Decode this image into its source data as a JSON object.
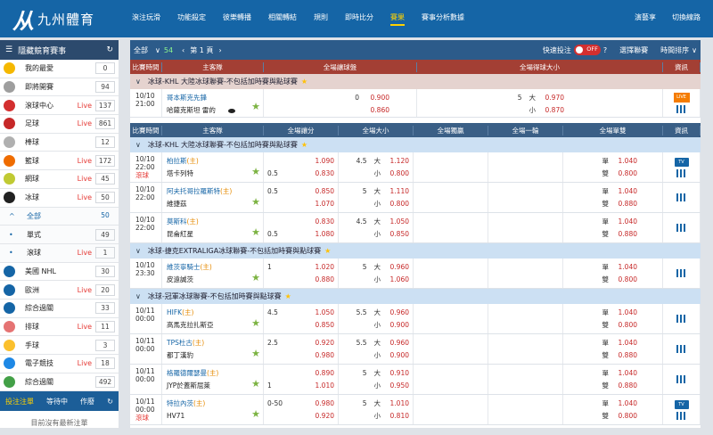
{
  "header": {
    "logo_mark": "从",
    "logo_text": "九州體育",
    "nav": [
      "滾注玩滑",
      "功能殺定",
      "彼樂轉播",
      "相關轉結",
      "規則",
      "即時比分",
      "賽果",
      "賽事分析數據"
    ],
    "nav_active_index": 6,
    "right": [
      "演藝享",
      "切換線路"
    ]
  },
  "sidebar": {
    "title": "隱藏競育賽事",
    "items": [
      {
        "label": "我的最愛",
        "count": "0",
        "icon": "star-icon",
        "color": "#f5b800"
      },
      {
        "label": "即將開賽",
        "count": "94",
        "icon": "clock-icon",
        "color": "#9e9e9e"
      },
      {
        "label": "滾球中心",
        "live": "Live",
        "count": "137",
        "icon": "play-icon",
        "color": "#d32f2f"
      },
      {
        "label": "足球",
        "live": "Live",
        "count": "861",
        "icon": "soccer-icon",
        "color": "#c62828"
      },
      {
        "label": "棒球",
        "count": "12",
        "icon": "baseball-icon",
        "color": "#b0b0b0"
      },
      {
        "label": "籃球",
        "live": "Live",
        "count": "172",
        "icon": "basketball-icon",
        "color": "#ef6c00"
      },
      {
        "label": "網球",
        "live": "Live",
        "count": "45",
        "icon": "tennis-icon",
        "color": "#c0ca33"
      },
      {
        "label": "冰球",
        "live": "Live",
        "count": "50",
        "icon": "hockey-icon",
        "color": "#212121"
      }
    ],
    "sub_items": [
      {
        "label": "全部",
        "count": "50"
      },
      {
        "label": "單式",
        "count": "49"
      },
      {
        "label": "滾球",
        "live": "Live",
        "count": "1"
      }
    ],
    "items2": [
      {
        "label": "美國 NHL",
        "count": "30",
        "icon": "hockey-icon",
        "color": "#1565a6"
      },
      {
        "label": "歐洲",
        "live": "Live",
        "count": "20",
        "icon": "hockey-icon",
        "color": "#1565a6"
      },
      {
        "label": "綜合過關",
        "count": "33",
        "icon": "hockey-icon",
        "color": "#1565a6"
      },
      {
        "label": "排球",
        "live": "Live",
        "count": "11",
        "icon": "volleyball-icon",
        "color": "#e57373"
      },
      {
        "label": "手球",
        "count": "3",
        "icon": "handball-icon",
        "color": "#fbc02d"
      },
      {
        "label": "電子競技",
        "live": "Live",
        "count": "18",
        "icon": "gamepad-icon",
        "color": "#1e88e5"
      },
      {
        "label": "綜合過關",
        "count": "492",
        "icon": "parlay-icon",
        "color": "#43a047"
      }
    ],
    "bottom_tabs": [
      "投注注單",
      "等待中",
      "作廢"
    ],
    "empty_text": "目前沒有最新注單"
  },
  "toolbar": {
    "all": "全部",
    "count": "54",
    "page": "第 1 頁",
    "quick_bet": "快速投注",
    "toggle": "OFF",
    "select_league": "選擇聯賽",
    "time_sort": "時間排序"
  },
  "live_section": {
    "headers": [
      "比賽時間",
      "主客隊",
      "全場讓球盤",
      "全場得球大小",
      "資訊"
    ],
    "league": "冰球-KHL 大陸冰球聯賽-不包括加時賽與點球賽",
    "matches": [
      {
        "date": "10/10",
        "time": "21:00",
        "home": "哥本斯克先鋒",
        "away": "哈薩克斯坦 雷的",
        "hdp": [
          "0",
          "0.900",
          "",
          "0.860"
        ],
        "ou": [
          "5",
          "大",
          "0.970",
          "小",
          "0.870"
        ]
      }
    ]
  },
  "main_section": {
    "headers": [
      "比賽時間",
      "主客隊",
      "全場讓分",
      "全場大小",
      "全場獨贏",
      "全場一輪",
      "全場單雙",
      "資訊"
    ],
    "leagues": [
      {
        "name": "冰球-KHL 大陸冰球聯賽-不包括加時賽與點球賽",
        "matches": [
          {
            "date": "10/10",
            "time": "22:00",
            "status": "滾球",
            "home": "柏拉斯",
            "mark": "(主)",
            "away": "塔卡列特",
            "hdp": [
              "",
              "1.090",
              "0.5",
              "0.830"
            ],
            "ou": [
              "4.5",
              "大",
              "1.120",
              "小",
              "0.800"
            ],
            "oe": [
              "單",
              "1.040",
              "雙",
              "0.800"
            ],
            "tv": true
          },
          {
            "date": "10/10",
            "time": "22:00",
            "home": "阿夫托哥拉羅斯特",
            "mark": "(主)",
            "away": "維捷茲",
            "hdp": [
              "0.5",
              "0.850",
              "",
              "1.070"
            ],
            "ou": [
              "5",
              "大",
              "1.110",
              "小",
              "0.800"
            ],
            "oe": [
              "單",
              "1.040",
              "雙",
              "0.880"
            ]
          },
          {
            "date": "10/10",
            "time": "22:00",
            "home": "莫斯科",
            "mark": "(主)",
            "away": "昆侖紅星",
            "hdp": [
              "",
              "0.830",
              "0.5",
              "1.080"
            ],
            "ou": [
              "4.5",
              "大",
              "1.050",
              "小",
              "0.850"
            ],
            "oe": [
              "單",
              "1.040",
              "雙",
              "0.880"
            ]
          }
        ]
      },
      {
        "name": "冰球-捷克EXTRALIGA冰球聯賽-不包括加時賽與點球賽",
        "matches": [
          {
            "date": "10/10",
            "time": "23:30",
            "home": "維茨寧騎士",
            "mark": "(主)",
            "away": "皮遠誠茨",
            "hdp": [
              "1",
              "1.020",
              "",
              "0.880"
            ],
            "ou": [
              "5",
              "大",
              "0.960",
              "小",
              "1.060"
            ],
            "oe": [
              "單",
              "1.040",
              "雙",
              "0.800"
            ]
          }
        ]
      },
      {
        "name": "冰球-冠軍冰球聯賽-不包括加時賽與點球賽",
        "matches": [
          {
            "date": "10/11",
            "time": "00:00",
            "home": "HIFK",
            "mark": "(主)",
            "away": "高馬克拉扎斯亞",
            "hdp": [
              "4.5",
              "1.050",
              "",
              "0.850"
            ],
            "ou": [
              "5.5",
              "大",
              "0.960",
              "小",
              "0.900"
            ],
            "oe": [
              "單",
              "1.040",
              "雙",
              "0.800"
            ]
          },
          {
            "date": "10/11",
            "time": "00:00",
            "home": "TPS杜古",
            "mark": "(主)",
            "away": "都丁漢豹",
            "hdp": [
              "2.5",
              "0.920",
              "",
              "0.980"
            ],
            "ou": [
              "5.5",
              "大",
              "0.960",
              "小",
              "0.900"
            ],
            "oe": [
              "單",
              "1.040",
              "雙",
              "0.880"
            ]
          },
          {
            "date": "10/11",
            "time": "00:00",
            "home": "格羅德爾瑟曼",
            "mark": "(主)",
            "away": "JYP於蓋斯屈萊",
            "hdp": [
              "",
              "0.890",
              "1",
              "1.010"
            ],
            "ou": [
              "5",
              "大",
              "0.910",
              "小",
              "0.950"
            ],
            "oe": [
              "單",
              "1.040",
              "雙",
              "0.880"
            ]
          },
          {
            "date": "10/11",
            "time": "00:00",
            "status": "滾球",
            "home": "特拉內茨",
            "mark": "(主)",
            "away": "HV71",
            "hdp": [
              "0-50",
              "0.980",
              "",
              "0.920"
            ],
            "ou": [
              "5",
              "大",
              "1.010",
              "小",
              "0.810"
            ],
            "oe": [
              "單",
              "1.040",
              "雙",
              "0.800"
            ],
            "tv": true
          }
        ]
      }
    ]
  },
  "colors": {
    "header": "#1565a6",
    "odds": "#c62828",
    "accent": "#ffd200"
  }
}
